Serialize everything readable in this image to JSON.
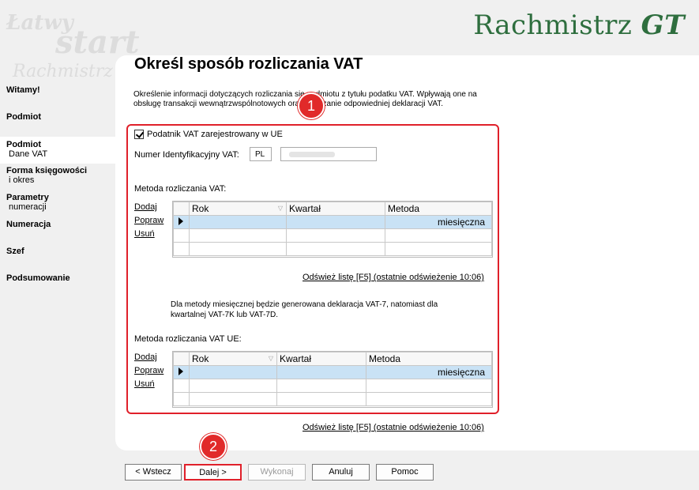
{
  "header": {
    "brand_main": "Rachmistrz",
    "brand_suffix": "GT",
    "watermark_1": "Łatwy",
    "watermark_2": "start",
    "watermark_3": "Rachmistrz"
  },
  "sidebar": {
    "items": [
      {
        "title": "Witamy!",
        "sub": ""
      },
      {
        "title": "Podmiot",
        "sub": ""
      },
      {
        "title": "Podmiot",
        "sub": "Dane VAT"
      },
      {
        "title": "Forma księgowości",
        "sub": "i okres"
      },
      {
        "title": "Parametry",
        "sub": "numeracji"
      },
      {
        "title": "Numeracja",
        "sub": ""
      },
      {
        "title": "Szef",
        "sub": ""
      },
      {
        "title": "Podsumowanie",
        "sub": ""
      }
    ]
  },
  "main": {
    "title": "Określ sposób rozliczania VAT",
    "description": "Określenie informacji dotyczących rozliczania się podmiotu z tytułu podatku VAT. Wpływają one na obsługę transakcji wewnątrzwspólnotowych oraz wyliczanie odpowiedniej deklaracji VAT.",
    "checkbox_label": "Podatnik VAT zarejestrowany w UE",
    "checkbox_checked": true,
    "nip_label": "Numer Identyfikacyjny VAT:",
    "nip_prefix": "PL",
    "nip_value": "",
    "vat": {
      "label": "Metoda rozliczania VAT:",
      "links": [
        "Dodaj",
        "Popraw",
        "Usuń"
      ],
      "columns": [
        "Rok",
        "Kwartał",
        "Metoda"
      ],
      "rows": [
        {
          "rok": "",
          "kwartal": "",
          "metoda": "miesięczna"
        }
      ],
      "refresh": "Odśwież listę [F5] (ostatnie odświeżenie 10:06)"
    },
    "note": "Dla metody miesięcznej będzie generowana deklaracja VAT-7, natomiast dla kwartalnej VAT-7K lub VAT-7D.",
    "vat_ue": {
      "label": "Metoda rozliczania VAT UE:",
      "links": [
        "Dodaj",
        "Popraw",
        "Usuń"
      ],
      "columns": [
        "Rok",
        "Kwartał",
        "Metoda"
      ],
      "rows": [
        {
          "rok": "",
          "kwartal": "",
          "metoda": "miesięczna"
        }
      ],
      "refresh": "Odśwież listę [F5] (ostatnie odświeżenie 10:06)"
    }
  },
  "annotations": {
    "badge_1": "1",
    "badge_2": "2"
  },
  "buttons": {
    "back": "< Wstecz",
    "next": "Dalej >",
    "execute": "Wykonaj",
    "cancel": "Anuluj",
    "help": "Pomoc"
  },
  "colors": {
    "brand": "#2e6e3e",
    "highlight": "#e0202a",
    "selected_row": "#c9e2f5"
  }
}
